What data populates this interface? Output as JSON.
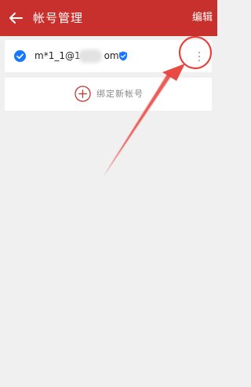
{
  "header": {
    "title": "帐号管理",
    "edit_label": "编辑",
    "background_color": "#c8302d",
    "back_icon": "arrow-left-icon"
  },
  "accounts": [
    {
      "email": "m*1_1@1",
      "email_suffix": "om",
      "selected": true,
      "verified": true,
      "check_icon": "check-circle-icon",
      "verified_icon": "shield-check-icon",
      "more_icon": "more-vertical-icon"
    }
  ],
  "bind_new": {
    "label": "绑定新帐号",
    "icon": "plus-circle-icon"
  },
  "annotation": {
    "color": "#e8413a",
    "shapes": [
      "circle",
      "arrow"
    ]
  },
  "colors": {
    "accent_red": "#c8302d",
    "check_blue": "#1677ff",
    "page_background": "#f0f0f0"
  }
}
